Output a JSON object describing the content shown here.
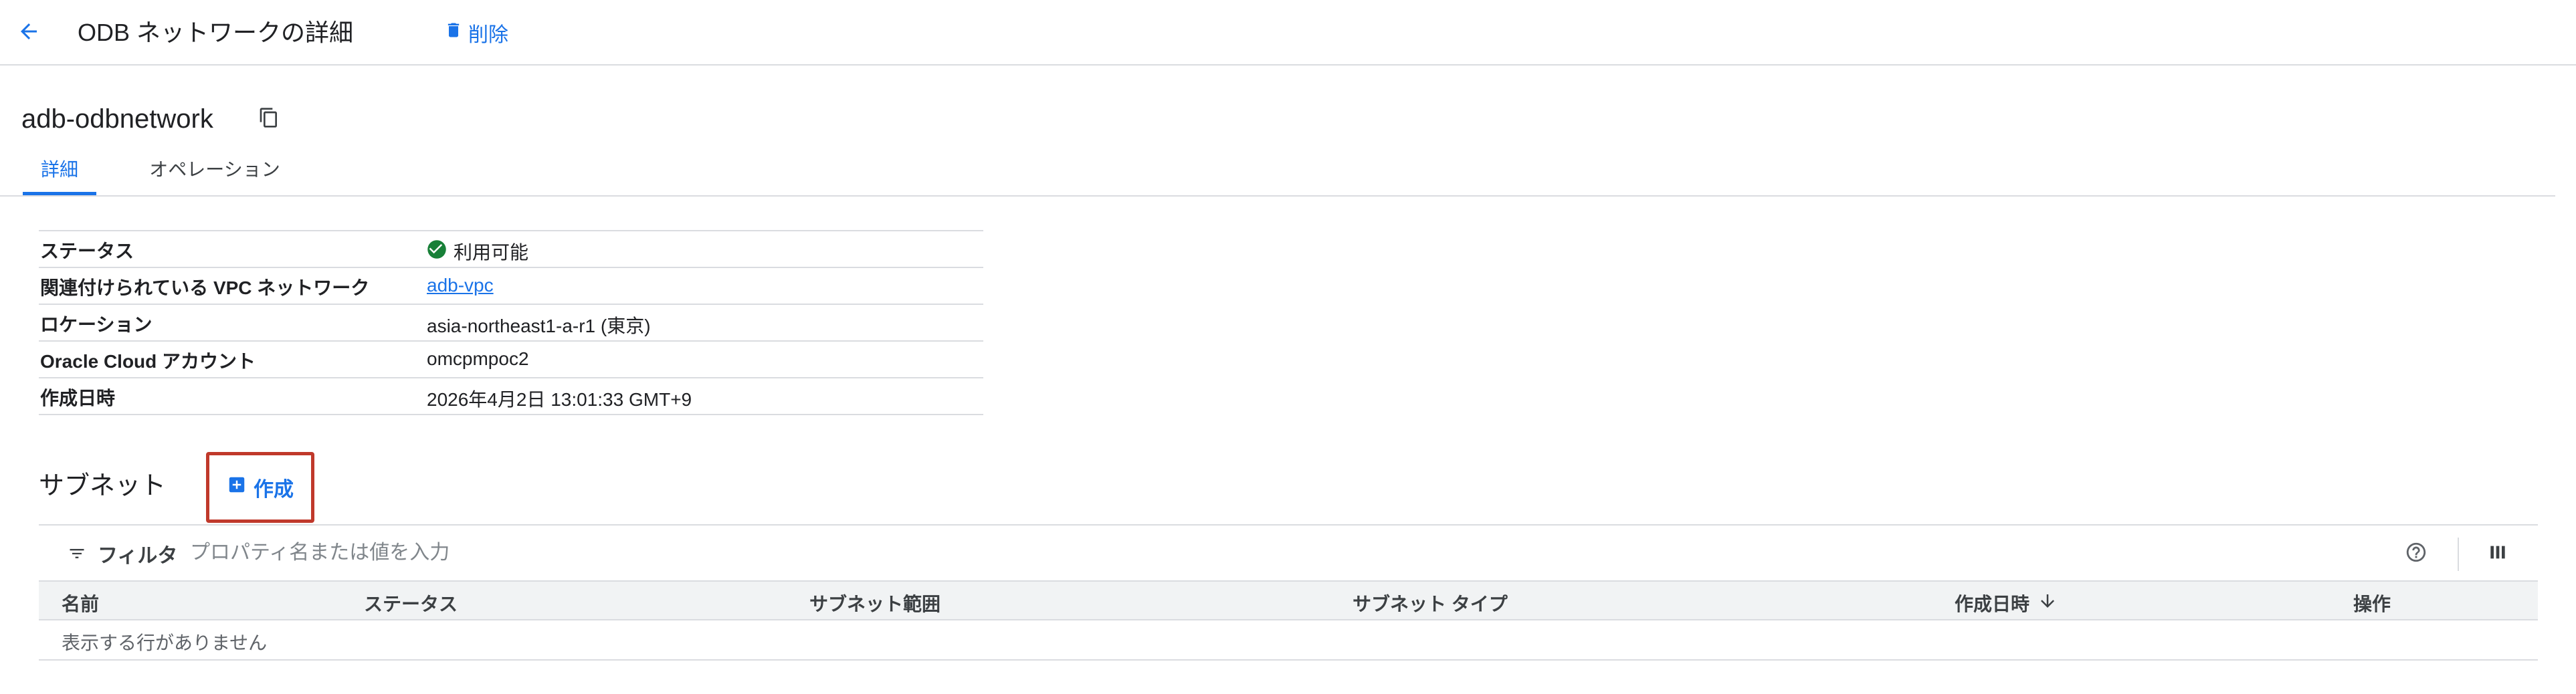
{
  "header": {
    "title": "ODB ネットワークの詳細",
    "delete_label": "削除",
    "back_icon": "arrow-back-icon",
    "delete_icon": "trash-icon"
  },
  "resource": {
    "name": "adb-odbnetwork",
    "copy_icon": "copy-icon"
  },
  "tabs": [
    {
      "label": "詳細",
      "active": true
    },
    {
      "label": "オペレーション",
      "active": false
    }
  ],
  "details": [
    {
      "label": "ステータス",
      "value": "利用可能",
      "icon": "check-circle-icon"
    },
    {
      "label": "関連付けられている VPC ネットワーク",
      "value": "adb-vpc"
    },
    {
      "label": "ロケーション",
      "value": "asia-northeast1-a-r1 (東京)"
    },
    {
      "label": "Oracle Cloud アカウント",
      "value": "omcpmpoc2"
    },
    {
      "label": "作成日時",
      "value": "2026年4月2日 13:01:33 GMT+9"
    }
  ],
  "subnet": {
    "title": "サブネット",
    "create_label": "作成",
    "create_icon": "add-box-icon"
  },
  "table": {
    "filter_label": "フィルタ",
    "filter_placeholder": "プロパティ名または値を入力",
    "filter_icon": "filter-list-icon",
    "help_icon": "help-circle-icon",
    "columns_icon": "view-columns-icon",
    "columns": [
      "名前",
      "ステータス",
      "サブネット範囲",
      "サブネット タイプ",
      "作成日時",
      "操作"
    ],
    "sort_icon": "arrow-downward-icon",
    "empty_message": "表示する行がありません"
  },
  "colors": {
    "accent": "#1a73e8",
    "status_ok": "#188038",
    "highlight_border": "#c0392b"
  }
}
